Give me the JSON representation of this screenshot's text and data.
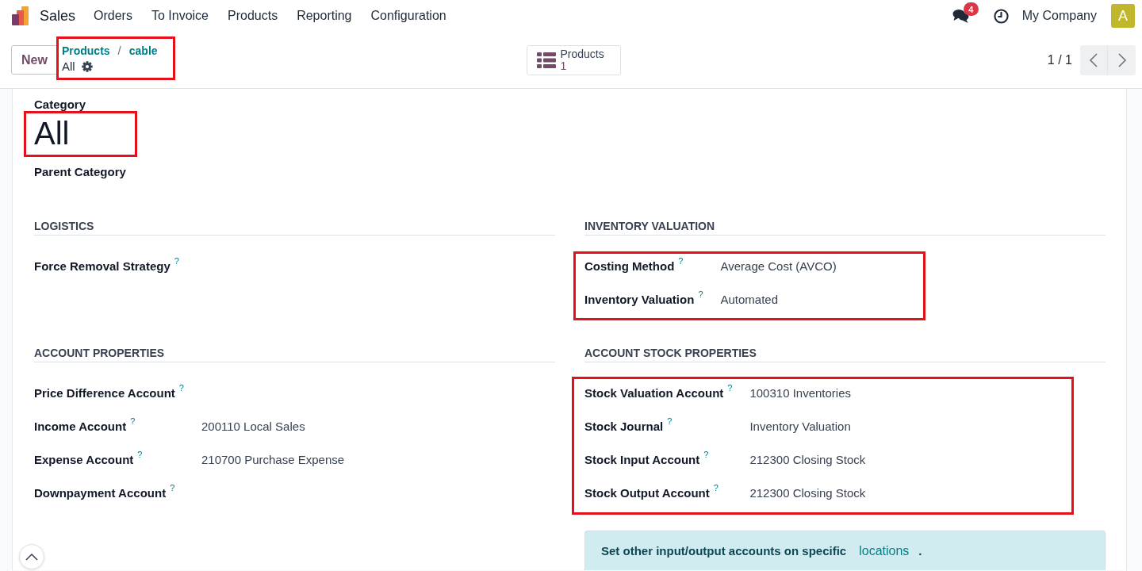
{
  "navbar": {
    "app_name": "Sales",
    "menu": [
      "Orders",
      "To Invoice",
      "Products",
      "Reporting",
      "Configuration"
    ],
    "messages_badge": "4",
    "company": "My Company",
    "avatar_initial": "A"
  },
  "control_panel": {
    "new_button": "New",
    "breadcrumb": {
      "items": [
        "Products",
        "cable"
      ],
      "separator": "/",
      "current": "All",
      "highlighted": true
    },
    "smart_button": {
      "label": "Products",
      "count": "1"
    },
    "pager": "1 / 1"
  },
  "form": {
    "category_label": "Category",
    "title": {
      "text": "All",
      "highlighted": true
    },
    "parent_category_label": "Parent Category",
    "groups": [
      {
        "title": "LOGISTICS",
        "highlighted": false,
        "fields": [
          {
            "label": "Force Removal Strategy",
            "help": "?"
          }
        ]
      },
      {
        "title": "INVENTORY VALUATION",
        "highlighted": true,
        "fields": [
          {
            "label": "Costing Method",
            "help": "?",
            "value": "Average Cost (AVCO)"
          },
          {
            "label": "Inventory Valuation",
            "help": "?",
            "value": "Automated"
          }
        ]
      },
      {
        "title": "ACCOUNT PROPERTIES",
        "highlighted": false,
        "fields": [
          {
            "label": "Price Difference Account",
            "help": "?"
          },
          {
            "label": "Income Account",
            "help": "?",
            "value": "200110 Local Sales"
          },
          {
            "label": "Expense Account",
            "help": "?",
            "value": "210700 Purchase Expense"
          },
          {
            "label": "Downpayment Account",
            "help": "?"
          }
        ]
      },
      {
        "title": "ACCOUNT STOCK PROPERTIES",
        "highlighted": true,
        "fields": [
          {
            "label": "Stock Valuation Account",
            "help": "?",
            "value": "100310 Inventories"
          },
          {
            "label": "Stock Journal",
            "help": "?",
            "value": "Inventory Valuation"
          },
          {
            "label": "Stock Input Account",
            "help": "?",
            "value": "212300 Closing Stock"
          },
          {
            "label": "Stock Output Account",
            "help": "?",
            "value": "212300 Closing Stock"
          }
        ],
        "note": {
          "text": "Set other input/output accounts on specific",
          "link": "locations",
          "end": "."
        }
      }
    ]
  }
}
